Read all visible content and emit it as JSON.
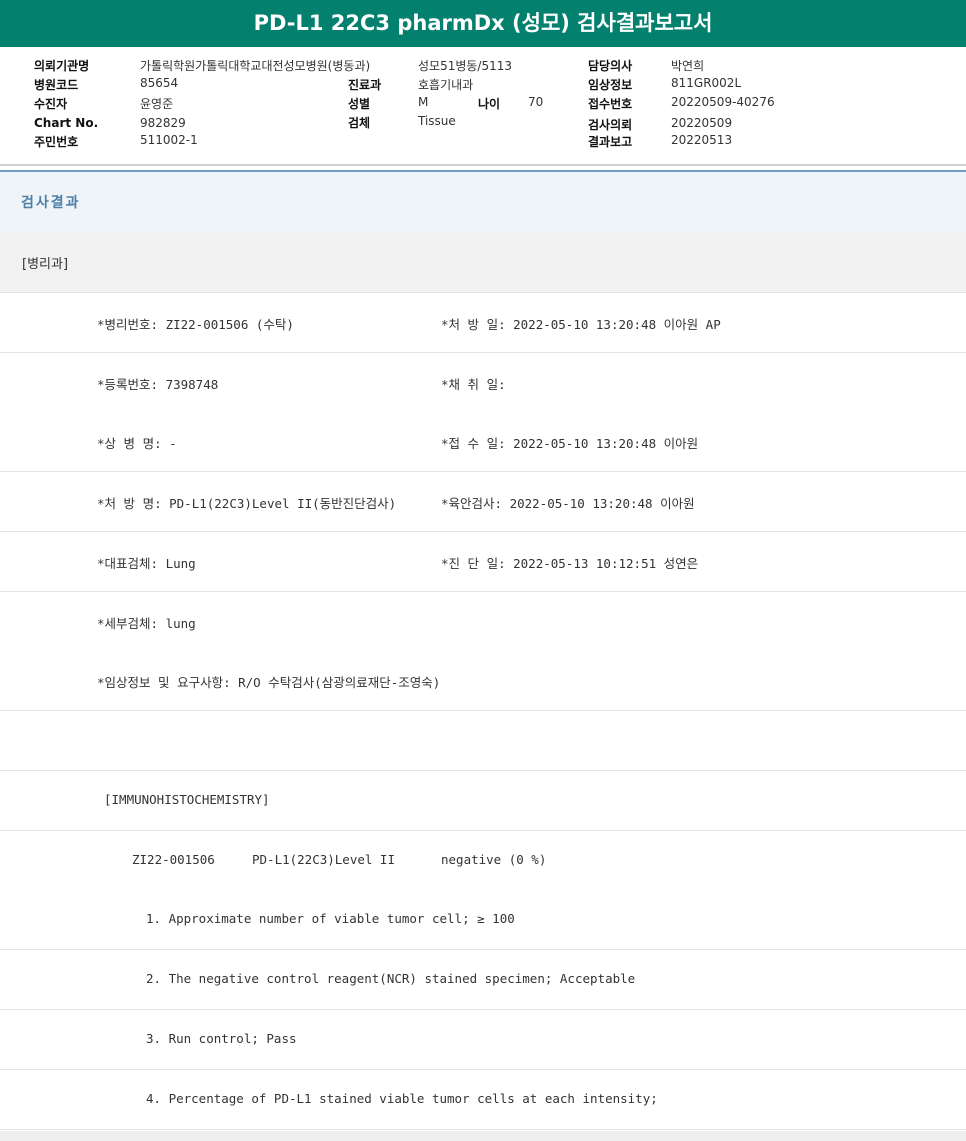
{
  "title": "PD-L1 22C3 pharmDx (성모) 검사결과보고서",
  "info": {
    "requesting_org_label": "의뢰기관명",
    "requesting_org": "가톨릭학원가톨릭대학교대전성모병원(병동과)",
    "ward": "성모51병동/5113",
    "doctor_label": "담당의사",
    "doctor": "박연희",
    "hospital_code_label": "병원코드",
    "hospital_code": "85654",
    "dept_label": "진료과",
    "dept": "호흡기내과",
    "clinical_info_label": "임상정보",
    "clinical_info": "811GR002L",
    "examinee_label": "수진자",
    "examinee": "윤영준",
    "sex_label": "성별",
    "sex": "M",
    "age_label": "나이",
    "age": "70",
    "receipt_no_label": "접수번호",
    "receipt_no": "20220509-40276",
    "chart_label": "Chart No.",
    "chart_no": "982829",
    "specimen_label": "검체",
    "specimen": "Tissue",
    "request_date_label": "검사의뢰",
    "request_date": "20220509",
    "resident_no_label": "주민번호",
    "resident_no": "511002-1",
    "report_date_label": "결과보고",
    "report_date": "20220513"
  },
  "results_header": "검사결과",
  "department": "[병리과]",
  "rows": [
    {
      "left": "*병리번호: ZI22-001506 (수탁)",
      "right": "*처 방 일: 2022-05-10 13:20:48  이아원 AP"
    },
    {
      "left": "*등록번호: 7398748",
      "right": "*채 취 일:"
    },
    {
      "left": "*상 병 명: -",
      "right": "*접 수 일: 2022-05-10 13:20:48  이아원"
    },
    {
      "left": "*처 방 명: PD-L1(22C3)Level II(동반진단검사)",
      "right": "*육안검사: 2022-05-10 13:20:48  이아원"
    },
    {
      "left": "*대표검체: Lung",
      "right": "*진 단 일: 2022-05-13 10:12:51  성연은"
    },
    {
      "left": "*세부검체: lung",
      "right": ""
    },
    {
      "left": "*임상정보 및 요구사항: R/O 수탁검사(삼광의료재단-조영숙)",
      "right": ""
    },
    {
      "left": "",
      "right": ""
    }
  ],
  "ihc": {
    "heading": "[IMMUNOHISTOCHEMISTRY]",
    "case_no": "ZI22-001506",
    "test_name": "PD-L1(22C3)Level II",
    "result": "negative (0 %)",
    "items": [
      "1. Approximate number of viable tumor cell; ≥ 100",
      "2. The negative control reagent(NCR) stained specimen; Acceptable",
      "3. Run control; Pass",
      "4. Percentage of PD-L1 stained viable tumor cells at each intensity;"
    ]
  }
}
